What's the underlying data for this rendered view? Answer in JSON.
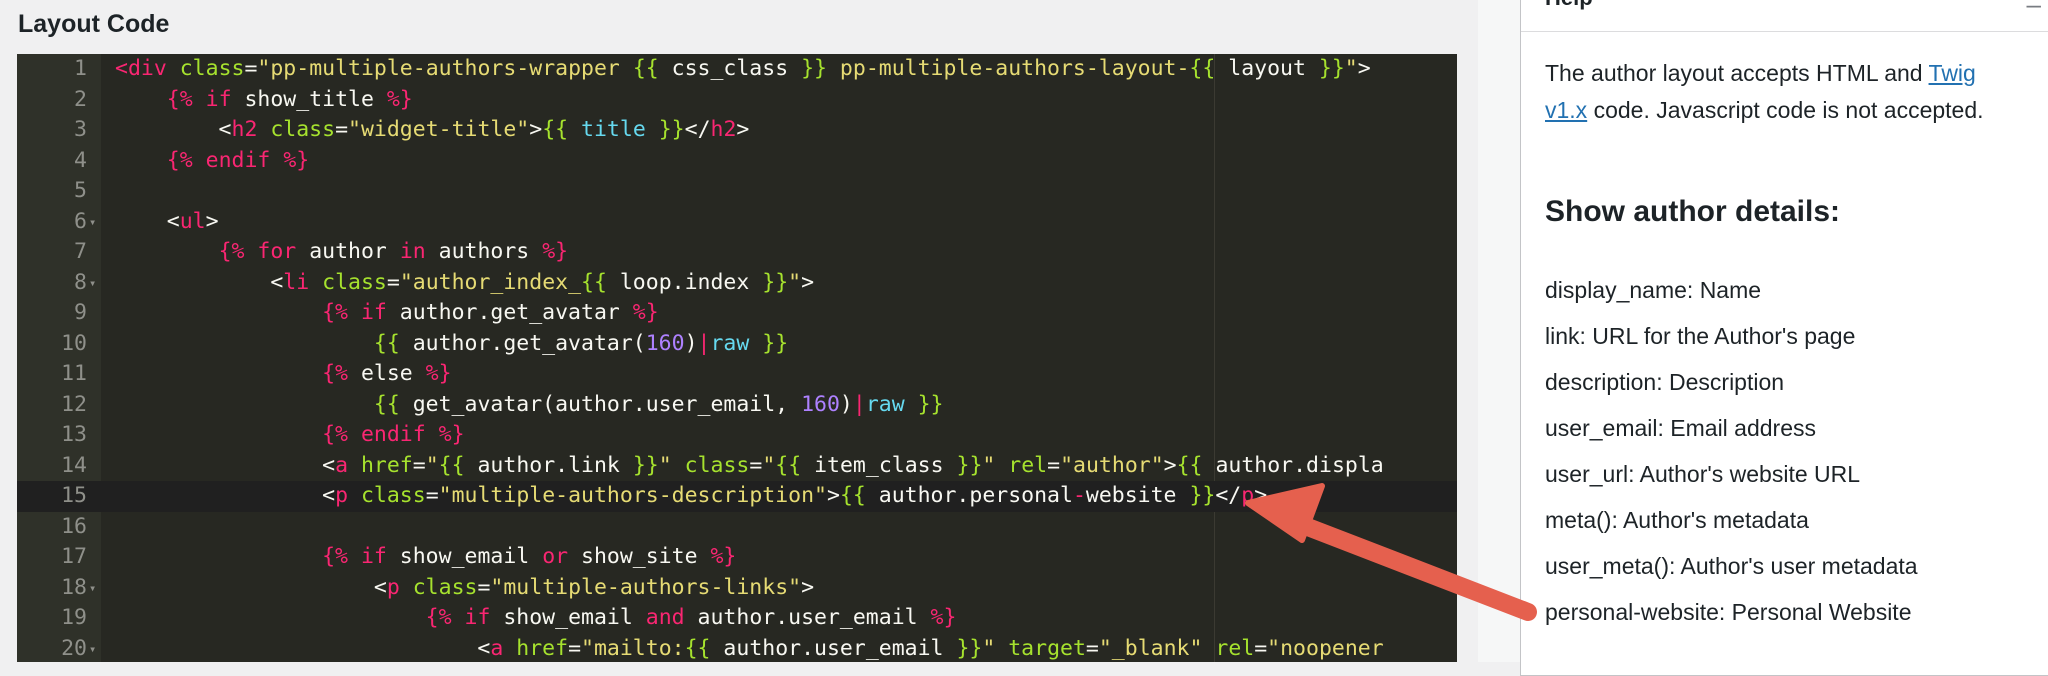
{
  "layout_code": {
    "title": "Layout Code",
    "lines": [
      {
        "n": "1",
        "fold": false,
        "tokens": [
          [
            "tag",
            "<div"
          ],
          [
            "txt",
            " "
          ],
          [
            "attr",
            "class"
          ],
          [
            "txt",
            "="
          ],
          [
            "str",
            "\"pp-multiple-authors-wrapper "
          ],
          [
            "tw",
            "{{"
          ],
          [
            "txt",
            " css_class "
          ],
          [
            "tw",
            "}}"
          ],
          [
            "str",
            " pp-multiple-authors-layout-"
          ],
          [
            "tw",
            "{{"
          ],
          [
            "txt",
            " layout "
          ],
          [
            "tw",
            "}}"
          ],
          [
            "str",
            "\""
          ],
          [
            "txt",
            ">"
          ]
        ]
      },
      {
        "n": "2",
        "fold": false,
        "tokens": [
          [
            "txt",
            "    "
          ],
          [
            "kw",
            "{%"
          ],
          [
            "txt",
            " "
          ],
          [
            "kw",
            "if"
          ],
          [
            "txt",
            " show_title "
          ],
          [
            "kw",
            "%}"
          ]
        ]
      },
      {
        "n": "3",
        "fold": false,
        "tokens": [
          [
            "txt",
            "        <"
          ],
          [
            "tag",
            "h2"
          ],
          [
            "txt",
            " "
          ],
          [
            "attr",
            "class"
          ],
          [
            "txt",
            "="
          ],
          [
            "str",
            "\"widget-title\""
          ],
          [
            "txt",
            ">"
          ],
          [
            "tw",
            "{{"
          ],
          [
            "txt",
            " "
          ],
          [
            "var",
            "title"
          ],
          [
            "txt",
            " "
          ],
          [
            "tw",
            "}}"
          ],
          [
            "txt",
            "</"
          ],
          [
            "tag",
            "h2"
          ],
          [
            "txt",
            ">"
          ]
        ]
      },
      {
        "n": "4",
        "fold": false,
        "tokens": [
          [
            "txt",
            "    "
          ],
          [
            "kw",
            "{%"
          ],
          [
            "txt",
            " "
          ],
          [
            "kw",
            "endif"
          ],
          [
            "txt",
            " "
          ],
          [
            "kw",
            "%}"
          ]
        ]
      },
      {
        "n": "5",
        "fold": false,
        "tokens": []
      },
      {
        "n": "6",
        "fold": true,
        "tokens": [
          [
            "txt",
            "    <"
          ],
          [
            "tag",
            "ul"
          ],
          [
            "txt",
            ">"
          ]
        ]
      },
      {
        "n": "7",
        "fold": false,
        "tokens": [
          [
            "txt",
            "        "
          ],
          [
            "kw",
            "{%"
          ],
          [
            "txt",
            " "
          ],
          [
            "kw",
            "for"
          ],
          [
            "txt",
            " author "
          ],
          [
            "kw",
            "in"
          ],
          [
            "txt",
            " authors "
          ],
          [
            "kw",
            "%}"
          ]
        ]
      },
      {
        "n": "8",
        "fold": true,
        "tokens": [
          [
            "txt",
            "            <"
          ],
          [
            "tag",
            "li"
          ],
          [
            "txt",
            " "
          ],
          [
            "attr",
            "class"
          ],
          [
            "txt",
            "="
          ],
          [
            "str",
            "\"author_index_"
          ],
          [
            "tw",
            "{{"
          ],
          [
            "txt",
            " loop.index "
          ],
          [
            "tw",
            "}}"
          ],
          [
            "str",
            "\""
          ],
          [
            "txt",
            ">"
          ]
        ]
      },
      {
        "n": "9",
        "fold": false,
        "tokens": [
          [
            "txt",
            "                "
          ],
          [
            "kw",
            "{%"
          ],
          [
            "txt",
            " "
          ],
          [
            "kw",
            "if"
          ],
          [
            "txt",
            " author.get_avatar "
          ],
          [
            "kw",
            "%}"
          ]
        ]
      },
      {
        "n": "10",
        "fold": false,
        "tokens": [
          [
            "txt",
            "                    "
          ],
          [
            "tw",
            "{{"
          ],
          [
            "txt",
            " author.get_avatar("
          ],
          [
            "num",
            "160"
          ],
          [
            "txt",
            ")"
          ],
          [
            "pipe",
            "|"
          ],
          [
            "var",
            "raw"
          ],
          [
            "txt",
            " "
          ],
          [
            "tw",
            "}}"
          ]
        ]
      },
      {
        "n": "11",
        "fold": false,
        "tokens": [
          [
            "txt",
            "                "
          ],
          [
            "kw",
            "{%"
          ],
          [
            "txt",
            " else "
          ],
          [
            "kw",
            "%}"
          ]
        ]
      },
      {
        "n": "12",
        "fold": false,
        "tokens": [
          [
            "txt",
            "                    "
          ],
          [
            "tw",
            "{{"
          ],
          [
            "txt",
            " get_avatar(author.user_email, "
          ],
          [
            "num",
            "160"
          ],
          [
            "txt",
            ")"
          ],
          [
            "pipe",
            "|"
          ],
          [
            "var",
            "raw"
          ],
          [
            "txt",
            " "
          ],
          [
            "tw",
            "}}"
          ]
        ]
      },
      {
        "n": "13",
        "fold": false,
        "tokens": [
          [
            "txt",
            "                "
          ],
          [
            "kw",
            "{%"
          ],
          [
            "txt",
            " "
          ],
          [
            "kw",
            "endif"
          ],
          [
            "txt",
            " "
          ],
          [
            "kw",
            "%}"
          ]
        ]
      },
      {
        "n": "14",
        "fold": false,
        "tokens": [
          [
            "txt",
            "                <"
          ],
          [
            "tag",
            "a"
          ],
          [
            "txt",
            " "
          ],
          [
            "attr",
            "href"
          ],
          [
            "txt",
            "="
          ],
          [
            "str",
            "\""
          ],
          [
            "tw",
            "{{"
          ],
          [
            "txt",
            " author.link "
          ],
          [
            "tw",
            "}}"
          ],
          [
            "str",
            "\""
          ],
          [
            "txt",
            " "
          ],
          [
            "attr",
            "class"
          ],
          [
            "txt",
            "="
          ],
          [
            "str",
            "\""
          ],
          [
            "tw",
            "{{"
          ],
          [
            "txt",
            " item_class "
          ],
          [
            "tw",
            "}}"
          ],
          [
            "str",
            "\""
          ],
          [
            "txt",
            " "
          ],
          [
            "attr",
            "rel"
          ],
          [
            "txt",
            "="
          ],
          [
            "str",
            "\"author\""
          ],
          [
            "txt",
            ">"
          ],
          [
            "tw",
            "{{"
          ],
          [
            "txt",
            " author.displa"
          ]
        ]
      },
      {
        "n": "15",
        "fold": false,
        "active": true,
        "tokens": [
          [
            "txt",
            "                <"
          ],
          [
            "tag",
            "p"
          ],
          [
            "txt",
            " "
          ],
          [
            "attr",
            "class"
          ],
          [
            "txt",
            "="
          ],
          [
            "str",
            "\"multiple-authors-description\""
          ],
          [
            "txt",
            ">"
          ],
          [
            "tw",
            "{{"
          ],
          [
            "txt",
            " author.personal"
          ],
          [
            "kw",
            "-"
          ],
          [
            "txt",
            "website "
          ],
          [
            "tw",
            "}}"
          ],
          [
            "txt",
            "</"
          ],
          [
            "tag",
            "p"
          ],
          [
            "txt",
            ">"
          ]
        ]
      },
      {
        "n": "16",
        "fold": false,
        "tokens": []
      },
      {
        "n": "17",
        "fold": false,
        "tokens": [
          [
            "txt",
            "                "
          ],
          [
            "kw",
            "{%"
          ],
          [
            "txt",
            " "
          ],
          [
            "kw",
            "if"
          ],
          [
            "txt",
            " show_email "
          ],
          [
            "kw",
            "or"
          ],
          [
            "txt",
            " show_site "
          ],
          [
            "kw",
            "%}"
          ]
        ]
      },
      {
        "n": "18",
        "fold": true,
        "tokens": [
          [
            "txt",
            "                    <"
          ],
          [
            "tag",
            "p"
          ],
          [
            "txt",
            " "
          ],
          [
            "attr",
            "class"
          ],
          [
            "txt",
            "="
          ],
          [
            "str",
            "\"multiple-authors-links\""
          ],
          [
            "txt",
            ">"
          ]
        ]
      },
      {
        "n": "19",
        "fold": false,
        "tokens": [
          [
            "txt",
            "                        "
          ],
          [
            "kw",
            "{%"
          ],
          [
            "txt",
            " "
          ],
          [
            "kw",
            "if"
          ],
          [
            "txt",
            " show_email "
          ],
          [
            "kw",
            "and"
          ],
          [
            "txt",
            " author.user_email "
          ],
          [
            "kw",
            "%}"
          ]
        ]
      },
      {
        "n": "20",
        "fold": true,
        "tokens": [
          [
            "txt",
            "                            <"
          ],
          [
            "tag",
            "a"
          ],
          [
            "txt",
            " "
          ],
          [
            "attr",
            "href"
          ],
          [
            "txt",
            "="
          ],
          [
            "str",
            "\"mailto:"
          ],
          [
            "tw",
            "{{"
          ],
          [
            "txt",
            " author.user_email "
          ],
          [
            "tw",
            "}}"
          ],
          [
            "str",
            "\""
          ],
          [
            "txt",
            " "
          ],
          [
            "attr",
            "target"
          ],
          [
            "txt",
            "="
          ],
          [
            "str",
            "\"_blank\""
          ],
          [
            "txt",
            " "
          ],
          [
            "attr",
            "rel"
          ],
          [
            "txt",
            "="
          ],
          [
            "str",
            "\"noopener"
          ]
        ]
      }
    ]
  },
  "help": {
    "title": "Help",
    "toggle_icon": "collapse-icon",
    "intro_before": "The author layout accepts HTML and ",
    "intro_link": "Twig v1.x",
    "intro_after": " code. Javascript code is not accepted.",
    "details_title": "Show author details:",
    "fields": [
      "display_name: Name",
      "link: URL for the Author's page",
      "description: Description",
      "user_email: Email address",
      "user_url: Author's website URL",
      "meta(): Author's metadata",
      "user_meta(): Author's user metadata",
      "personal-website: Personal Website"
    ]
  },
  "annotation": {
    "icon": "arrow-annotation-icon",
    "color": "#e5604e"
  },
  "colors": {
    "editor_bg": "#272822",
    "gutter_bg": "#2f3129",
    "link": "#2271b1"
  }
}
